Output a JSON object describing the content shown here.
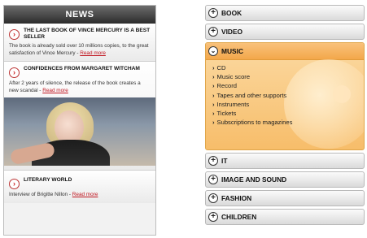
{
  "news": {
    "header": "NEWS",
    "articles": [
      {
        "title": "THE LAST BOOK OF VINCE MERCURY IS A BEST SELLER",
        "body": "The book is already sold over 10 millions copies, to the great satisfaction of Vince Mercury - ",
        "read_more": "Read more"
      },
      {
        "title": "CONFIDENCES FROM MARGARET WITCHAM",
        "body": "After 2 years of silence, the release of the book creates a new scandal - ",
        "read_more": "Read more"
      },
      {
        "title": "LITERARY WORLD",
        "body": "Interview of Brigitte Nillon - ",
        "read_more": "Read more"
      }
    ]
  },
  "menu": {
    "categories_top": [
      "BOOK",
      "VIDEO"
    ],
    "expanded": {
      "label": "MUSIC",
      "items": [
        "CD",
        "Music score",
        "Record",
        "Tapes and other supports",
        "Instruments",
        "Tickets",
        "Subscriptions to magazines"
      ]
    },
    "categories_bottom": [
      "IT",
      "IMAGE AND SOUND",
      "FASHION",
      "CHILDREN"
    ]
  },
  "colors": {
    "accent_red": "#c0141e",
    "expanded_orange": "#f7bd6a"
  }
}
